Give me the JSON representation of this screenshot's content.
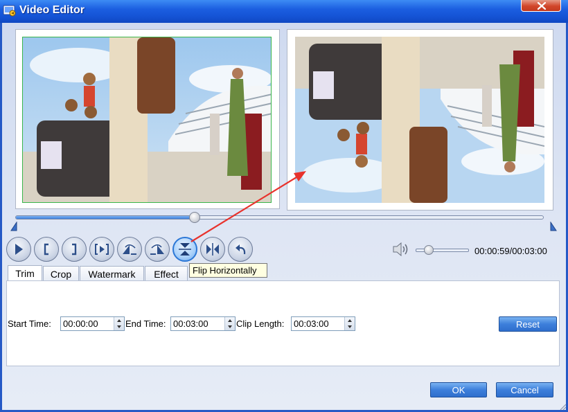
{
  "window": {
    "title": "Video Editor",
    "close_icon": "close-icon",
    "app_icon": "video-editor-app-icon"
  },
  "player": {
    "progress_fraction": 0.34,
    "controls": [
      {
        "name": "play-button",
        "icon": "play-icon"
      },
      {
        "name": "mark-in-button",
        "icon": "bracket-left-icon"
      },
      {
        "name": "mark-out-button",
        "icon": "bracket-right-icon"
      },
      {
        "name": "play-selection-button",
        "icon": "play-selection-icon"
      },
      {
        "name": "rotate-left-button",
        "icon": "rotate-left-icon"
      },
      {
        "name": "rotate-right-button",
        "icon": "rotate-right-icon"
      },
      {
        "name": "flip-horizontally-button",
        "icon": "flip-vertical-icon"
      },
      {
        "name": "flip-vertically-button",
        "icon": "flip-horizontal-icon"
      },
      {
        "name": "undo-button",
        "icon": "undo-icon"
      }
    ],
    "tooltip": "Flip Horizontally",
    "volume_fraction": 0.25,
    "time_readout": "00:00:59/00:03:00"
  },
  "tabs": [
    {
      "label": "Trim",
      "selected": true
    },
    {
      "label": "Crop",
      "selected": false
    },
    {
      "label": "Watermark",
      "selected": false
    },
    {
      "label": "Effect",
      "selected": false
    }
  ],
  "trim": {
    "start_label": "Start Time:",
    "start_value": "00:00:00",
    "end_label": "End Time:",
    "end_value": "00:03:00",
    "length_label": "Clip Length:",
    "length_value": "00:03:00",
    "reset_label": "Reset"
  },
  "footer": {
    "ok_label": "OK",
    "cancel_label": "Cancel"
  },
  "colors": {
    "title_bar": "#1b5ee0",
    "button_blue": "#3d7fdb",
    "annotation_arrow": "#e8322c"
  }
}
